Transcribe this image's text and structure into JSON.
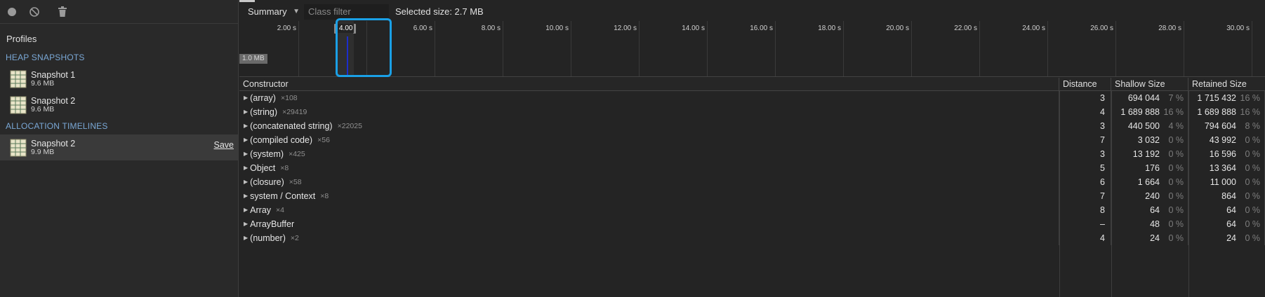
{
  "sidebar": {
    "profiles_title": "Profiles",
    "sections": [
      {
        "title": "HEAP SNAPSHOTS",
        "items": [
          {
            "name": "Snapshot 1",
            "size": "9.6 MB"
          },
          {
            "name": "Snapshot 2",
            "size": "9.6 MB"
          }
        ]
      },
      {
        "title": "ALLOCATION TIMELINES",
        "items": [
          {
            "name": "Snapshot 2",
            "size": "9.9 MB",
            "action": "Save"
          }
        ]
      }
    ]
  },
  "toolbar": {
    "view": "Summary",
    "filter_placeholder": "Class filter",
    "selected_size": "Selected size: 2.7 MB"
  },
  "timeline": {
    "ticks": [
      "2.00 s",
      "4.00 s",
      "6.00 s",
      "8.00 s",
      "10.00 s",
      "12.00 s",
      "14.00 s",
      "16.00 s",
      "18.00 s",
      "20.00 s",
      "22.00 s",
      "24.00 s",
      "26.00 s",
      "28.00 s",
      "30.00 s"
    ],
    "selection_label": "4.00",
    "memory_label": "1.0 MB"
  },
  "table": {
    "headers": {
      "constructor": "Constructor",
      "distance": "Distance",
      "shallow": "Shallow Size",
      "retained": "Retained Size"
    },
    "rows": [
      {
        "name": "(array)",
        "count": "×108",
        "distance": "3",
        "shallow": "694 044",
        "shallow_pct": "7 %",
        "retained": "1 715 432",
        "retained_pct": "16 %"
      },
      {
        "name": "(string)",
        "count": "×29419",
        "distance": "4",
        "shallow": "1 689 888",
        "shallow_pct": "16 %",
        "retained": "1 689 888",
        "retained_pct": "16 %"
      },
      {
        "name": "(concatenated string)",
        "count": "×22025",
        "distance": "3",
        "shallow": "440 500",
        "shallow_pct": "4 %",
        "retained": "794 604",
        "retained_pct": "8 %"
      },
      {
        "name": "(compiled code)",
        "count": "×56",
        "distance": "7",
        "shallow": "3 032",
        "shallow_pct": "0 %",
        "retained": "43 992",
        "retained_pct": "0 %"
      },
      {
        "name": "(system)",
        "count": "×425",
        "distance": "3",
        "shallow": "13 192",
        "shallow_pct": "0 %",
        "retained": "16 596",
        "retained_pct": "0 %"
      },
      {
        "name": "Object",
        "count": "×8",
        "distance": "5",
        "shallow": "176",
        "shallow_pct": "0 %",
        "retained": "13 364",
        "retained_pct": "0 %"
      },
      {
        "name": "(closure)",
        "count": "×58",
        "distance": "6",
        "shallow": "1 664",
        "shallow_pct": "0 %",
        "retained": "11 000",
        "retained_pct": "0 %"
      },
      {
        "name": "system / Context",
        "count": "×8",
        "distance": "7",
        "shallow": "240",
        "shallow_pct": "0 %",
        "retained": "864",
        "retained_pct": "0 %"
      },
      {
        "name": "Array",
        "count": "×4",
        "distance": "8",
        "shallow": "64",
        "shallow_pct": "0 %",
        "retained": "64",
        "retained_pct": "0 %"
      },
      {
        "name": "ArrayBuffer",
        "count": "",
        "distance": "–",
        "shallow": "48",
        "shallow_pct": "0 %",
        "retained": "64",
        "retained_pct": "0 %"
      },
      {
        "name": "(number)",
        "count": "×2",
        "distance": "4",
        "shallow": "24",
        "shallow_pct": "0 %",
        "retained": "24",
        "retained_pct": "0 %"
      }
    ]
  },
  "colors": {
    "accent": "#1aa0e6",
    "section_header": "#7aa8d6",
    "selection_bar": "#1c2dcc"
  }
}
